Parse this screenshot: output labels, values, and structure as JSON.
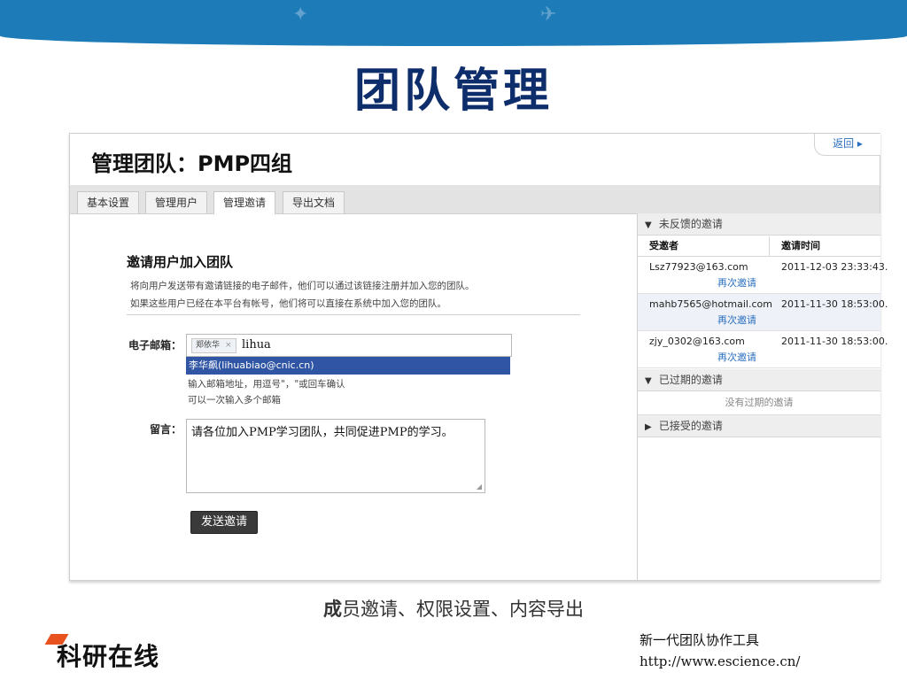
{
  "slide": {
    "title": "团队管理",
    "caption_lead": "成",
    "caption_rest": "员邀请、权限设置、内容导出",
    "logo": "科研在线",
    "slogan": "新一代团队协作工具",
    "url": "http://www.escience.cn/"
  },
  "app": {
    "page_title": "管理团队：PMP四组",
    "back_label": "返回 ▸",
    "tabs": [
      {
        "label": "基本设置"
      },
      {
        "label": "管理用户"
      },
      {
        "label": "管理邀请",
        "active": true
      },
      {
        "label": "导出文档"
      }
    ]
  },
  "invite_form": {
    "heading": "邀请用户加入团队",
    "desc_line1": "将向用户发送带有邀请链接的电子邮件，他们可以通过该链接注册并加入您的团队。",
    "desc_line2": "如果这些用户已经在本平台有帐号，他们将可以直接在系统中加入您的团队。",
    "email_label": "电子邮箱：",
    "email_token": "郑依华",
    "email_token_remove": "×",
    "email_typed": "lihua",
    "suggestion": "李华飙(lihuabiao@cnic.cn)",
    "hint_line1": "输入邮箱地址，用逗号\"，\"或回车确认",
    "hint_line2": "可以一次输入多个邮箱",
    "message_label": "留言：",
    "message_value": "请各位加入PMP学习团队，共同促进PMP的学习。",
    "send_label": "发送邀请"
  },
  "invites_panel": {
    "pending_title": "未反馈的邀请",
    "col_invitee": "受邀者",
    "col_time": "邀请时间",
    "rows": [
      {
        "email": "Lsz77923@163.com",
        "time": "2011-12-03 23:33:43.",
        "action": "再次邀请"
      },
      {
        "email": "mahb7565@hotmail.com",
        "time": "2011-11-30 18:53:00.",
        "action": "再次邀请"
      },
      {
        "email": "zjy_0302@163.com",
        "time": "2011-11-30 18:53:00.",
        "action": "再次邀请"
      }
    ],
    "expired_title": "已过期的邀请",
    "expired_empty": "没有过期的邀请",
    "accepted_title": "已接受的邀请",
    "arrow_expanded": "▼",
    "arrow_collapsed": "▶"
  }
}
